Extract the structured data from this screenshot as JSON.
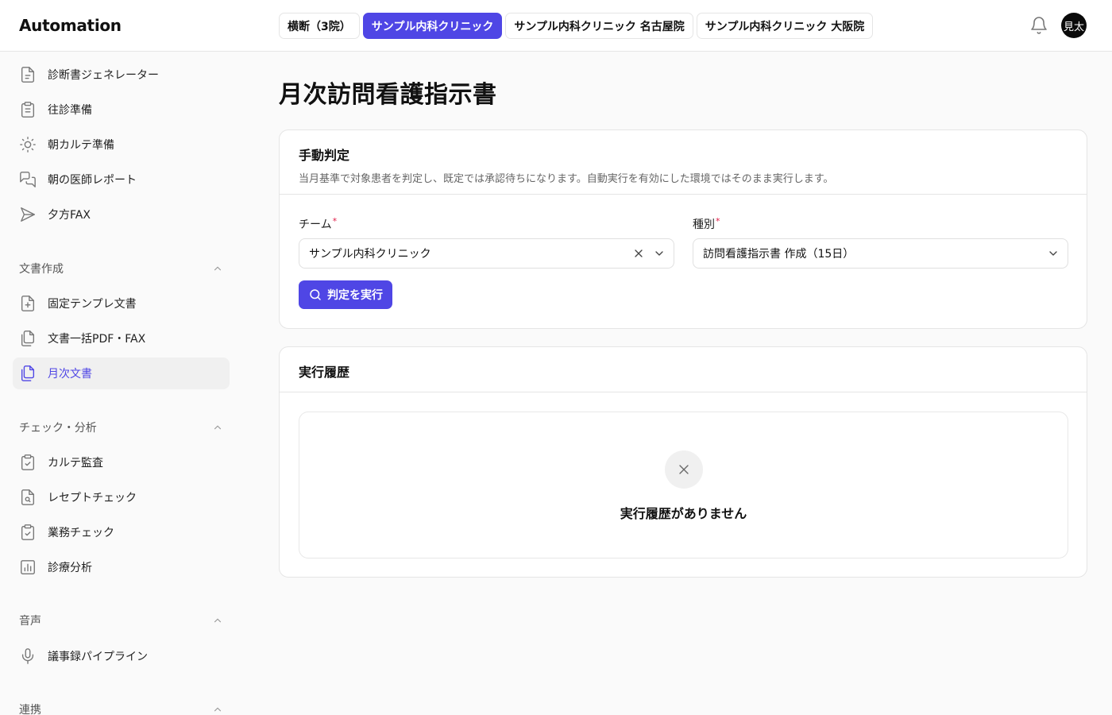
{
  "header": {
    "logo": "Automation",
    "tabs": [
      {
        "label": "横断（3院）",
        "active": false
      },
      {
        "label": "サンプル内科クリニック",
        "active": true
      },
      {
        "label": "サンプル内科クリニック 名古屋院",
        "active": false
      },
      {
        "label": "サンプル内科クリニック 大阪院",
        "active": false
      }
    ],
    "avatar": "見太",
    "accent_color": "#4f46e5"
  },
  "sidebar": {
    "top_items": [
      {
        "label": "診断書ジェネレーター",
        "icon": "document-icon"
      },
      {
        "label": "往診準備",
        "icon": "clipboard-list-icon"
      },
      {
        "label": "朝カルテ準備",
        "icon": "sun-icon"
      },
      {
        "label": "朝の医師レポート",
        "icon": "chat-bubbles-icon"
      },
      {
        "label": "夕方FAX",
        "icon": "send-icon"
      }
    ],
    "sections": [
      {
        "title": "文書作成",
        "items": [
          {
            "label": "固定テンプレ文書",
            "icon": "file-plus-icon",
            "active": false
          },
          {
            "label": "文書一括PDF・FAX",
            "icon": "files-icon",
            "active": false
          },
          {
            "label": "月次文書",
            "icon": "files-icon",
            "active": true
          }
        ]
      },
      {
        "title": "チェック・分析",
        "items": [
          {
            "label": "カルテ監査",
            "icon": "clipboard-check-icon",
            "active": false
          },
          {
            "label": "レセプトチェック",
            "icon": "file-search-icon",
            "active": false
          },
          {
            "label": "業務チェック",
            "icon": "clipboard-check-icon",
            "active": false
          },
          {
            "label": "診療分析",
            "icon": "bar-chart-icon",
            "active": false
          }
        ]
      },
      {
        "title": "音声",
        "items": [
          {
            "label": "議事録パイプライン",
            "icon": "microphone-icon",
            "active": false
          }
        ]
      },
      {
        "title": "連携",
        "items": []
      }
    ]
  },
  "main": {
    "title": "月次訪問看護指示書",
    "manual": {
      "title": "手動判定",
      "description": "当月基準で対象患者を判定し、既定では承認待ちになります。自動実行を有効にした環境ではそのまま実行します。",
      "team_label": "チーム",
      "team_value": "サンプル内科クリニック",
      "type_label": "種別",
      "type_value": "訪問看護指示書 作成（15日）",
      "run_button": "判定を実行"
    },
    "history": {
      "title": "実行履歴",
      "empty_text": "実行履歴がありません"
    }
  }
}
